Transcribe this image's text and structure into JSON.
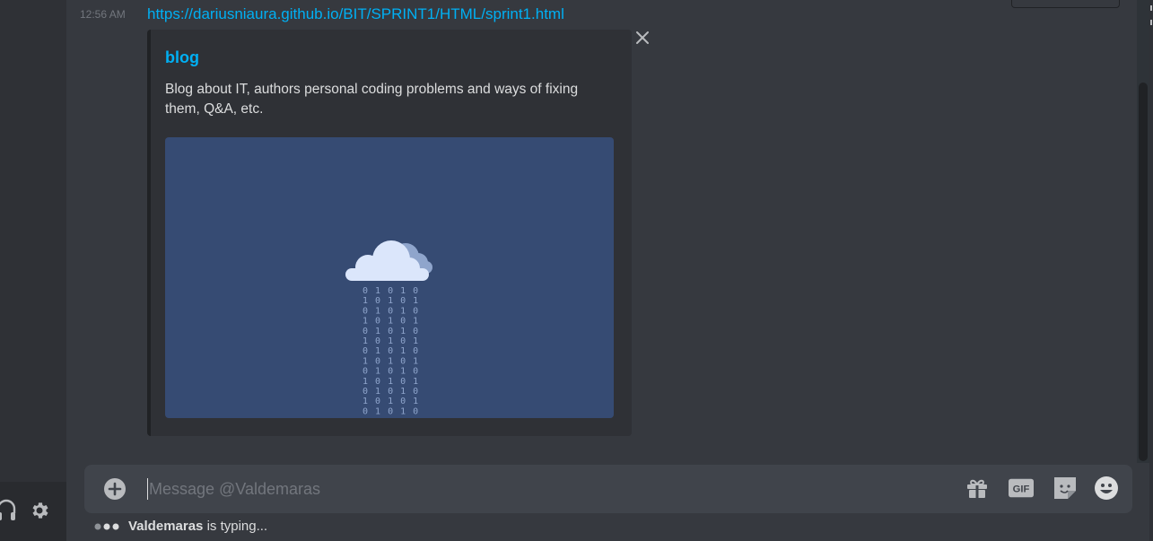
{
  "message": {
    "timestamp": "12:56 AM",
    "link_text": "https://dariusniaura.github.io/BIT/SPRINT1/HTML/sprint1.html"
  },
  "embed": {
    "title": "blog",
    "description": "Blog about IT, authors personal coding problems and ways of fixing them, Q&A, etc.",
    "binary_rows": [
      "0 1 0 1 0",
      "1 0 1 0 1",
      "0 1 0 1 0",
      "1 0 1 0 1",
      "0 1 0 1 0",
      "1 0 1 0 1",
      "0 1 0 1 0",
      "1 0 1 0 1",
      "0 1 0 1 0",
      "1 0 1 0 1",
      "0 1 0 1 0",
      "1 0 1 0 1",
      "0 1 0 1 0"
    ]
  },
  "composer": {
    "placeholder": "Message @Valdemaras"
  },
  "typing": {
    "user": "Valdemaras",
    "suffix": " is typing..."
  },
  "icons": {
    "close": "close-icon",
    "upload": "plus-circle-icon",
    "gift": "gift-icon",
    "gif": "gif-icon",
    "sticker": "sticker-icon",
    "emoji": "emoji-icon",
    "headset": "headset-icon",
    "settings": "gear-icon",
    "cloud": "cloud-icon"
  },
  "gif_label": "GIF",
  "colors": {
    "link": "#00b0f4",
    "background": "#36393f",
    "embed_bg": "#2f3136",
    "image_bg": "#364b73"
  }
}
